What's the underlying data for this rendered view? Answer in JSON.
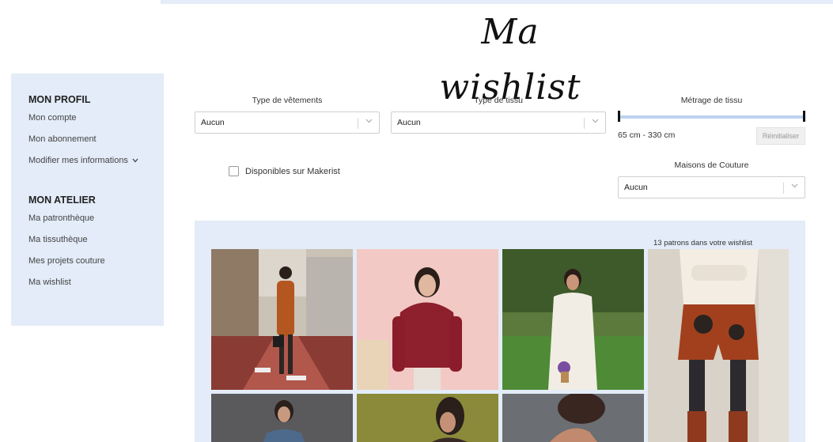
{
  "header": {
    "title": "Ma wishlist"
  },
  "sidebar": {
    "sections": [
      {
        "heading": "MON PROFIL",
        "items": [
          "Mon compte",
          "Mon abonnement",
          "Modifier mes informations"
        ]
      },
      {
        "heading": "MON ATELIER",
        "items": [
          "Ma patronthèque",
          "Ma tissuthèque",
          "Mes projets couture",
          "Ma wishlist"
        ]
      }
    ],
    "chevron_icon": "chevron-down-icon"
  },
  "filters": {
    "garment_type": {
      "label": "Type de vêtements",
      "value": "Aucun"
    },
    "fabric_type": {
      "label": "Type de tissu",
      "value": "Aucun"
    },
    "fabric_length": {
      "label": "Métrage de tissu",
      "range_text": "65 cm - 330 cm",
      "min": 65,
      "max": 330,
      "reset_label": "Réinitialiser"
    },
    "available_makerist": {
      "label": "Disponibles sur Makerist",
      "checked": false
    },
    "couture_houses": {
      "label": "Maisons de Couture",
      "value": "Aucun"
    }
  },
  "wishlist": {
    "count_text": "13 patrons dans votre wishlist"
  },
  "colors": {
    "panel_bg": "#e3ecf8",
    "slider_track": "#bcd3f0"
  }
}
